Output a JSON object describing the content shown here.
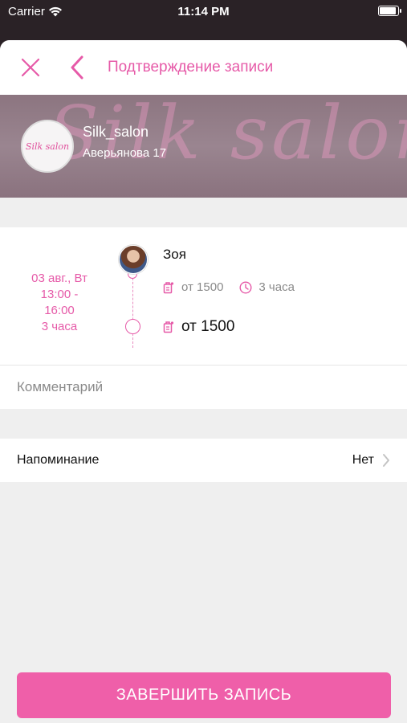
{
  "status_bar": {
    "carrier": "Carrier",
    "time": "11:14 PM",
    "wifi_icon": "wifi-icon",
    "battery_icon": "battery-icon"
  },
  "background": {
    "neon_text": "Silk salon"
  },
  "header": {
    "title": "Подтверждение записи",
    "close_icon": "close-icon",
    "back_icon": "chevron-left-icon",
    "accent_color": "#e65aa8"
  },
  "salon": {
    "logo_text": "Silk salon",
    "name": "Silk_salon",
    "address": "Аверьянова 17",
    "banner_text": "Silk salon"
  },
  "booking": {
    "date": "03 авг., Вт",
    "time_start": "13:00 -",
    "time_end": "16:00",
    "duration": "3 часа",
    "master": {
      "name": "Зоя",
      "avatar_icon": "avatar"
    },
    "service": {
      "price": "от 1500",
      "duration": "3 часа",
      "price_icon": "price-tag-icon",
      "clock_icon": "clock-icon"
    },
    "total": {
      "price": "от 1500"
    }
  },
  "comment": {
    "placeholder": "Комментарий"
  },
  "reminder": {
    "label": "Напоминание",
    "value": "Нет",
    "chevron_icon": "chevron-right-icon"
  },
  "actions": {
    "finish_label": "ЗАВЕРШИТЬ ЗАПИСЬ",
    "button_color": "#ef5fa9"
  }
}
